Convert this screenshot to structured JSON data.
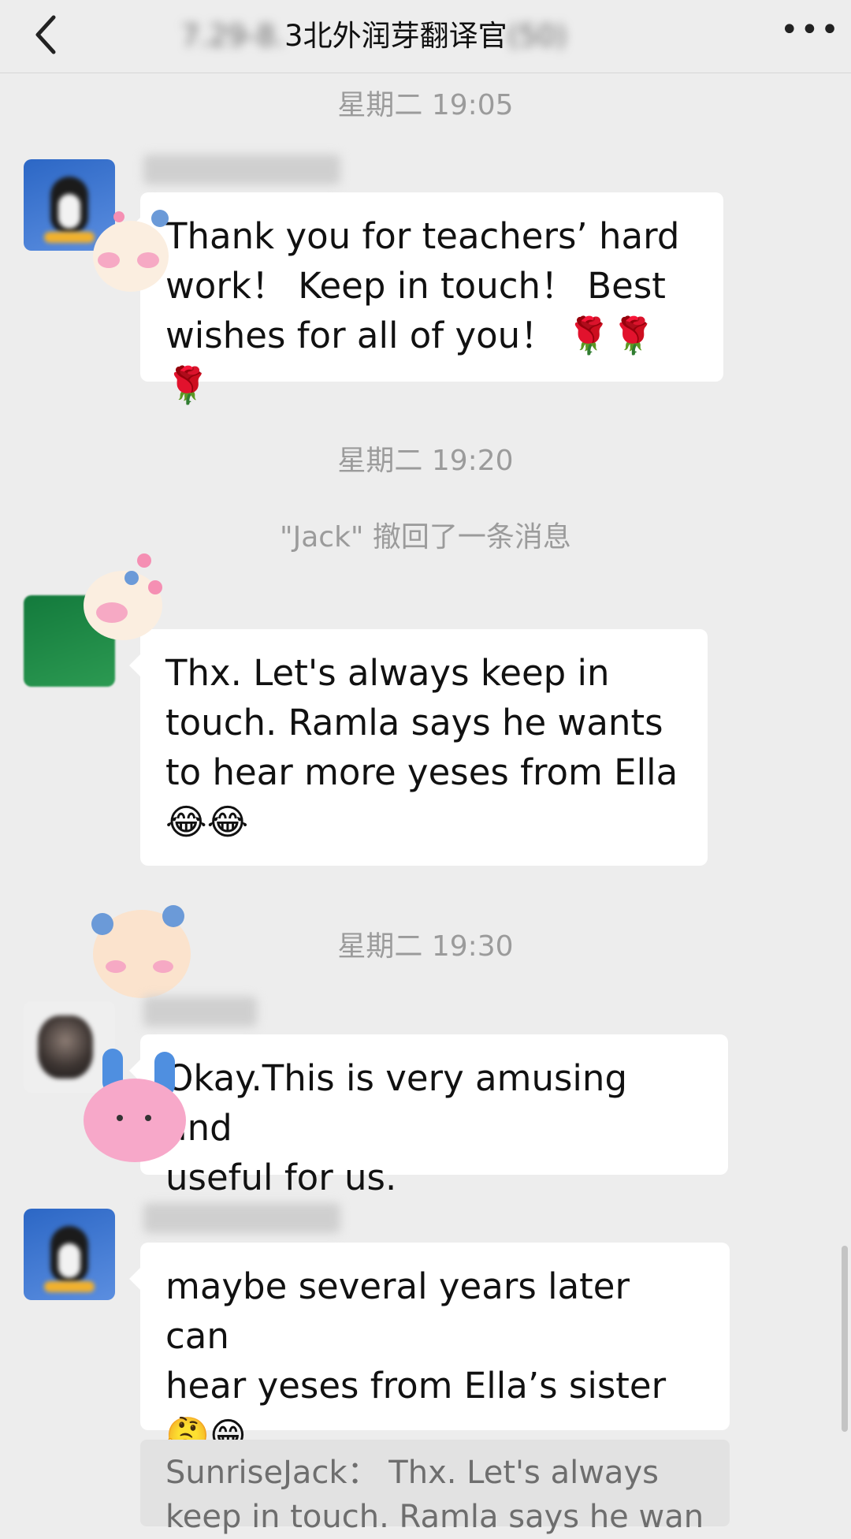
{
  "nav": {
    "back_icon": "chevron-left-icon",
    "title_blurred_prefix": "7.29-8.",
    "title_visible": "3北外润芽翻译官",
    "title_blurred_suffix": "(50)",
    "more_label": "•••"
  },
  "chat": {
    "time_1": "星期二 19:05",
    "msg_1": {
      "avatar": "penguin-avatar",
      "text_lines": [
        "Thank you for teachers’ hard",
        "work！ Keep in touch！ Best",
        "wishes for all of you！ 🌹🌹🌹"
      ]
    },
    "time_2": "星期二 19:20",
    "recall_notice": "\"Jack\" 撤回了一条消息",
    "msg_2": {
      "avatar": "green-avatar",
      "text_lines": [
        "Thx. Let's always keep in",
        "touch. Ramla says he wants",
        "to hear more yeses from Ella",
        "😂😂"
      ]
    },
    "time_3": "星期二 19:30",
    "msg_3": {
      "avatar": "photo-avatar",
      "text_lines": [
        "Okay.This is very amusing and",
        "useful for us."
      ]
    },
    "msg_4": {
      "avatar": "penguin-avatar",
      "text_lines": [
        "maybe several years later can",
        "hear yeses from Ella’s sister",
        "🤔😁"
      ]
    },
    "quote": {
      "text_lines": [
        "SunriseJack： Thx. Let's always",
        "keep in touch. Ramla says he wan"
      ]
    }
  },
  "colors": {
    "background": "#ededed",
    "bubble": "#ffffff",
    "timestamp_text": "#9b9b9b",
    "quote_bg": "#e2e2e2"
  }
}
